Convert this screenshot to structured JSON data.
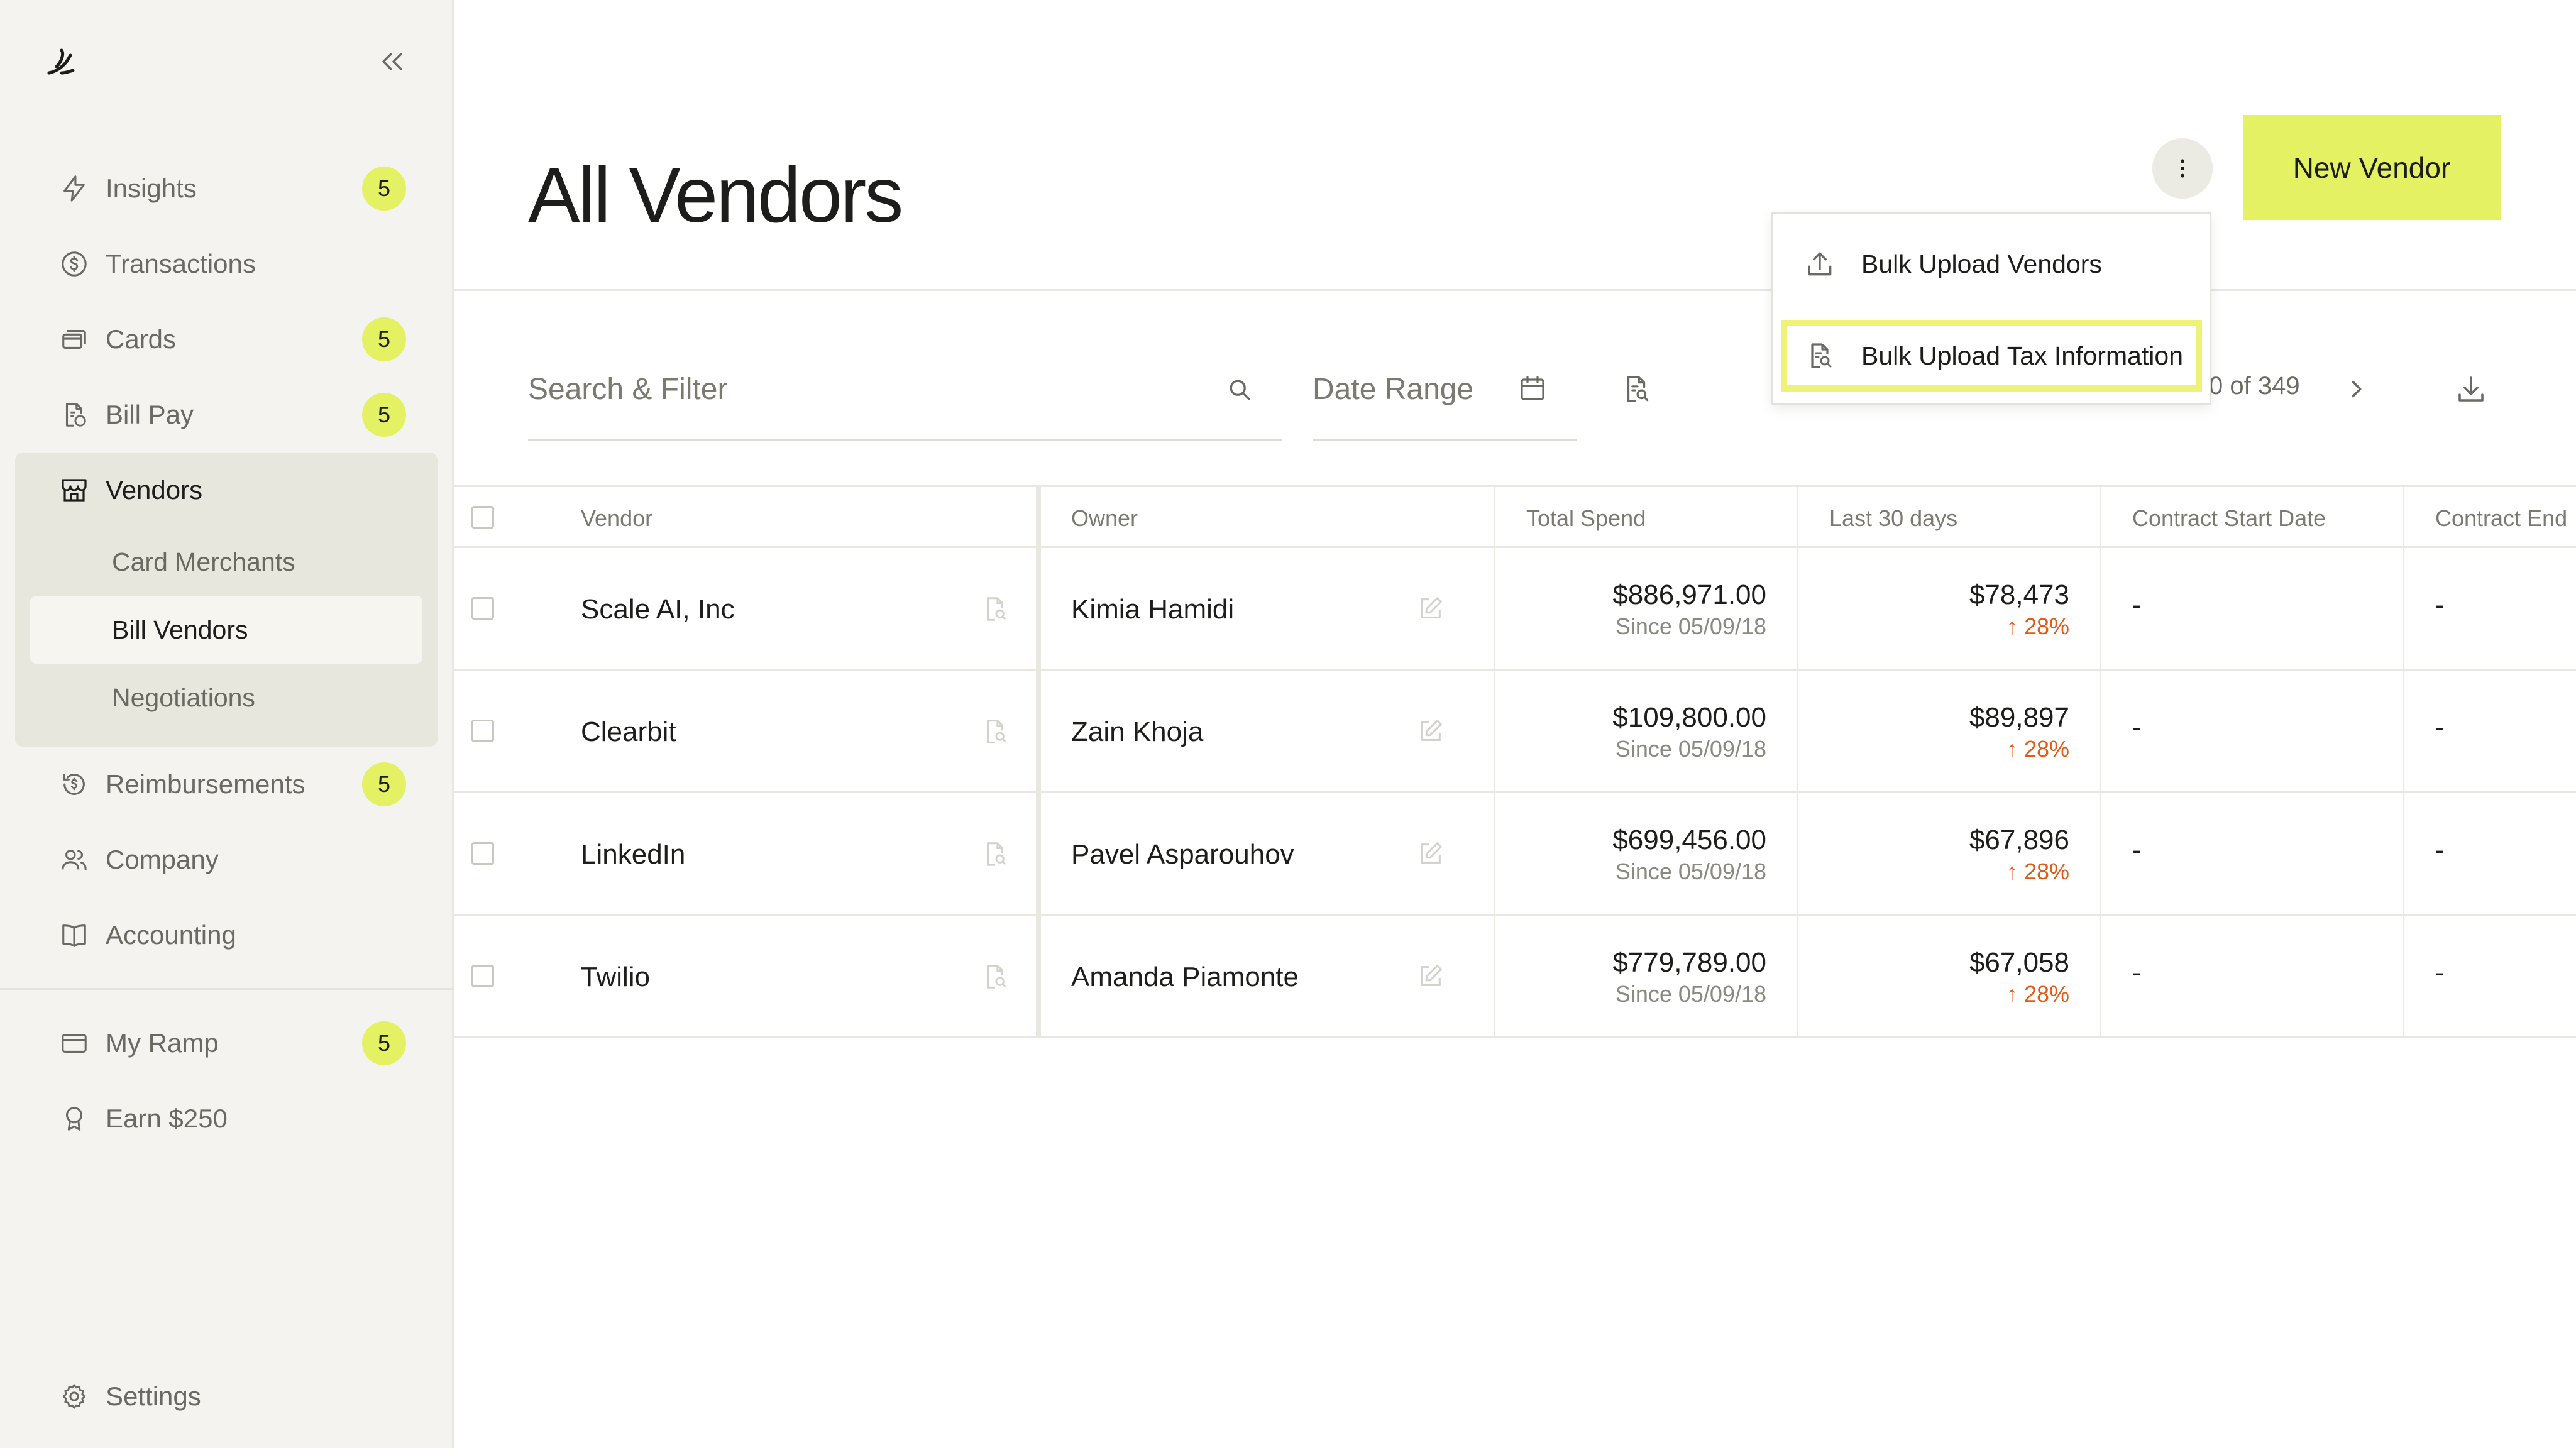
{
  "sidebar": {
    "nav": [
      {
        "label": "Insights",
        "icon": "bolt-icon",
        "badge": "5"
      },
      {
        "label": "Transactions",
        "icon": "dollar-circle-icon",
        "badge": ""
      },
      {
        "label": "Cards",
        "icon": "cards-icon",
        "badge": "5"
      },
      {
        "label": "Bill Pay",
        "icon": "bill-icon",
        "badge": "5"
      },
      {
        "label": "Vendors",
        "icon": "store-icon",
        "badge": ""
      },
      {
        "label": "Reimbursements",
        "icon": "refund-icon",
        "badge": "5"
      },
      {
        "label": "Company",
        "icon": "people-icon",
        "badge": ""
      },
      {
        "label": "Accounting",
        "icon": "book-icon",
        "badge": ""
      }
    ],
    "vendor_sub": [
      "Card Merchants",
      "Bill Vendors",
      "Negotiations"
    ],
    "bottom": [
      {
        "label": "My Ramp",
        "icon": "card-icon",
        "badge": "5"
      },
      {
        "label": "Earn $250",
        "icon": "award-icon",
        "badge": ""
      }
    ],
    "settings": "Settings"
  },
  "header": {
    "title": "All Vendors",
    "new_vendor": "New Vendor"
  },
  "dropdown": {
    "items": [
      "Bulk Upload Vendors",
      "Bulk Upload Tax Information"
    ]
  },
  "filters": {
    "search_placeholder": "Search & Filter",
    "date_range": "Date Range",
    "pagination": "0 of 349"
  },
  "table": {
    "columns": [
      "Vendor",
      "Owner",
      "Total Spend",
      "Last 30 days",
      "Contract Start Date",
      "Contract End"
    ],
    "rows": [
      {
        "vendor": "Scale AI, Inc",
        "owner": "Kimia Hamidi",
        "total": "$886,971.00",
        "since": "Since 05/09/18",
        "last30": "$78,473",
        "pct": "28%",
        "start": "-",
        "end": "-"
      },
      {
        "vendor": "Clearbit",
        "owner": "Zain Khoja",
        "total": "$109,800.00",
        "since": "Since 05/09/18",
        "last30": "$89,897",
        "pct": "28%",
        "start": "-",
        "end": "-"
      },
      {
        "vendor": "LinkedIn",
        "owner": "Pavel Asparouhov",
        "total": "$699,456.00",
        "since": "Since 05/09/18",
        "last30": "$67,896",
        "pct": "28%",
        "start": "-",
        "end": "-"
      },
      {
        "vendor": "Twilio",
        "owner": "Amanda Piamonte",
        "total": "$779,789.00",
        "since": "Since 05/09/18",
        "last30": "$67,058",
        "pct": "28%",
        "start": "-",
        "end": "-"
      }
    ]
  },
  "colors": {
    "accent": "#e4f163",
    "increase": "#e25a13",
    "sidebar_bg": "#f4f3ef"
  }
}
